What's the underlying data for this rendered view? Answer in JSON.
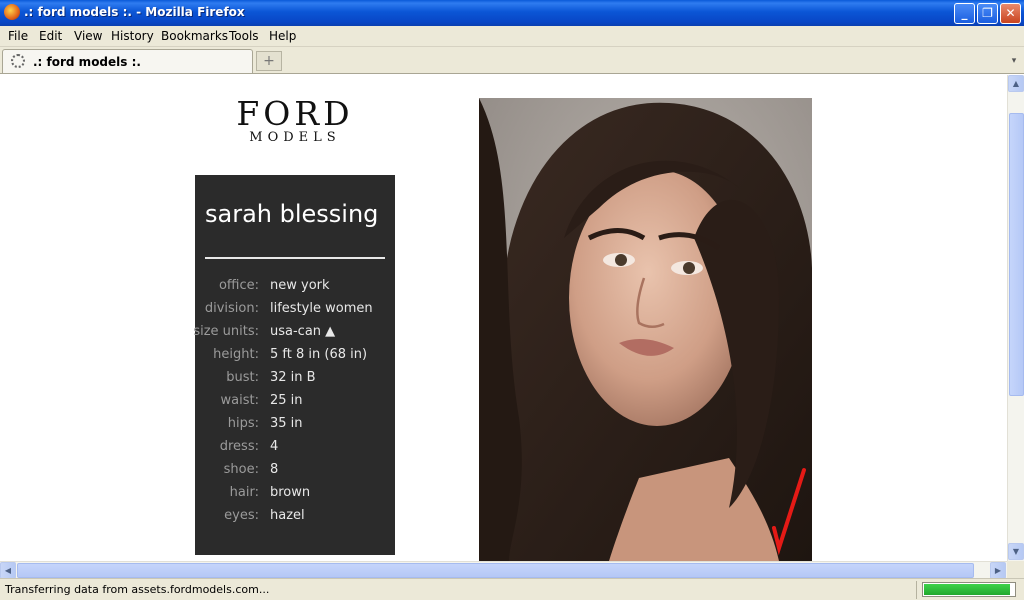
{
  "window": {
    "title": ".: ford models :. - Mozilla Firefox",
    "minimize": "_",
    "maximize": "❐",
    "close": "✕"
  },
  "menu": [
    "File",
    "Edit",
    "View",
    "History",
    "Bookmarks",
    "Tools",
    "Help"
  ],
  "tabs": [
    {
      "label": ".: ford models :.",
      "loading": true
    }
  ],
  "tab_controls": {
    "new_tab": "+",
    "list": "▾"
  },
  "logo": {
    "main": "FORD",
    "sub": "MODELS"
  },
  "profile": {
    "name": "sarah blessing",
    "stats": [
      {
        "label": "office:",
        "value": "new york"
      },
      {
        "label": "division:",
        "value": "lifestyle women"
      },
      {
        "label": "size units:",
        "value": "usa-can ▲"
      },
      {
        "label": "height:",
        "value": "5 ft 8 in (68 in)"
      },
      {
        "label": "bust:",
        "value": "32 in B"
      },
      {
        "label": "waist:",
        "value": "25 in"
      },
      {
        "label": "hips:",
        "value": "35 in"
      },
      {
        "label": "dress:",
        "value": "4"
      },
      {
        "label": "shoe:",
        "value": "8"
      },
      {
        "label": "hair:",
        "value": "brown"
      },
      {
        "label": "eyes:",
        "value": "hazel"
      }
    ]
  },
  "status": {
    "text": "Transferring data from assets.fordmodels.com...",
    "progress": 0.95
  },
  "scroll_icons": {
    "up": "▲",
    "down": "▼",
    "left": "◀",
    "right": "▶"
  },
  "colors": {
    "titlebar": "#0b56d6",
    "panel": "#2b2b2b",
    "progress": "#2ebf3a"
  }
}
